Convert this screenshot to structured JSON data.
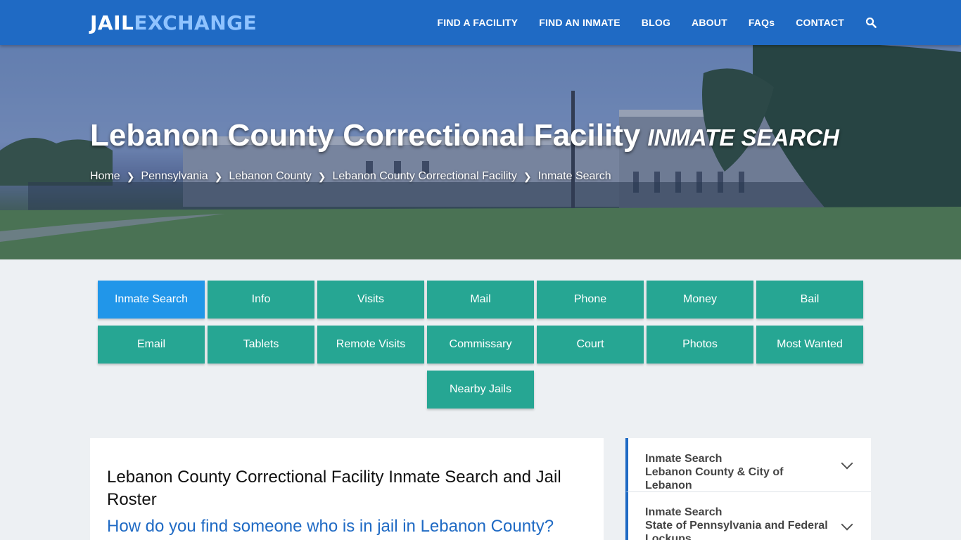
{
  "header": {
    "logo_part1": "JAIL",
    "logo_part2": "EXCHANGE",
    "nav": [
      "FIND A FACILITY",
      "FIND AN INMATE",
      "BLOG",
      "ABOUT",
      "FAQs",
      "CONTACT"
    ]
  },
  "hero": {
    "title": "Lebanon County Correctional Facility",
    "subtitle": "INMATE SEARCH",
    "breadcrumbs": [
      "Home",
      "Pennsylvania",
      "Lebanon County",
      "Lebanon County Correctional Facility",
      "Inmate Search"
    ]
  },
  "buttons": [
    [
      "Inmate Search",
      "Info",
      "Visits",
      "Mail",
      "Phone",
      "Money",
      "Bail"
    ],
    [
      "Email",
      "Tablets",
      "Remote Visits",
      "Commissary",
      "Court",
      "Photos",
      "Most Wanted"
    ],
    [
      "Nearby Jails"
    ]
  ],
  "active_button": "Inmate Search",
  "main": {
    "heading": "Lebanon County Correctional Facility Inmate Search and Jail Roster",
    "question": "How do you find someone who is in jail in Lebanon County?"
  },
  "sidebar": [
    {
      "line1": "Inmate Search",
      "line2": "Lebanon County & City of Lebanon"
    },
    {
      "line1": "Inmate Search",
      "line2": "State of Pennsylvania and Federal Lockups"
    }
  ],
  "colors": {
    "brand_blue": "#1f6ac4",
    "button_teal": "#26a693",
    "active_blue": "#2196e9"
  }
}
